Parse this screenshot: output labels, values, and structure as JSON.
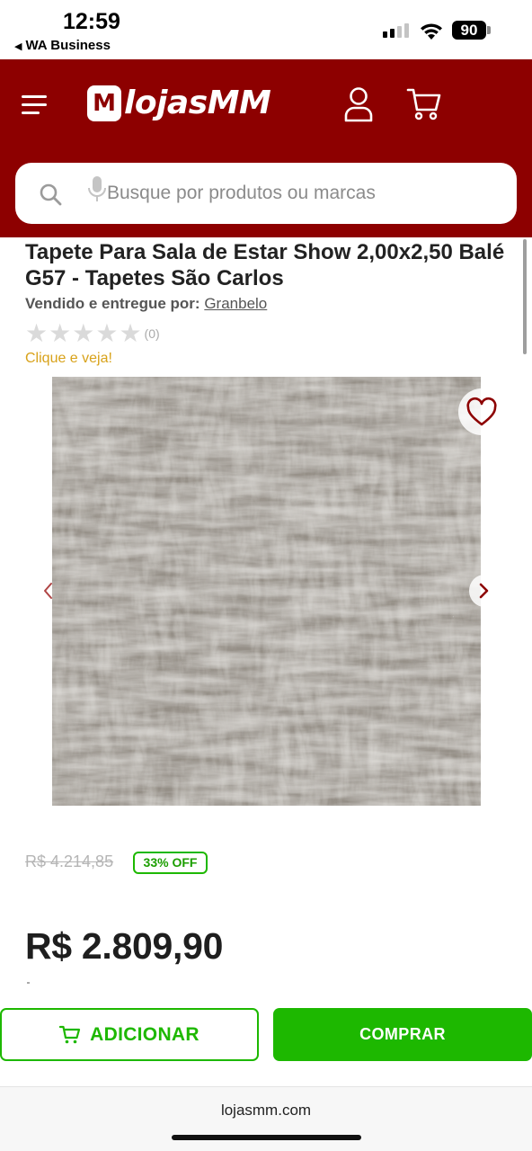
{
  "status_bar": {
    "time": "12:59",
    "back_app": "WA Business",
    "battery": "90"
  },
  "header": {
    "logo_badge": "M",
    "logo_text": "lojasMM",
    "search": {
      "placeholder": "Busque por produtos ou marcas"
    },
    "icons": [
      "menu-icon",
      "user-icon",
      "cart-icon",
      "search-icon",
      "mic-icon"
    ]
  },
  "product": {
    "title": "Tapete Para Sala de Estar Show 2,00x2,50 Balé G57 - Tapetes São Carlos",
    "seller_prefix": "Vendido e entregue por:",
    "seller_name": "Granbelo",
    "rating_stars": 0,
    "review_count": "(0)",
    "rating_cta": "Clique e veja!",
    "old_price": "R$ 4.214,85",
    "discount_badge": "33% OFF",
    "price": "R$ 2.809,90"
  },
  "actions": {
    "add_label": "ADICIONAR",
    "buy_label": "COMPRAR"
  },
  "browser": {
    "url": "lojasmm.com"
  },
  "colors": {
    "brand_red": "#8d0000",
    "accent_green": "#1db800",
    "rating_cta": "#d8a21a"
  }
}
